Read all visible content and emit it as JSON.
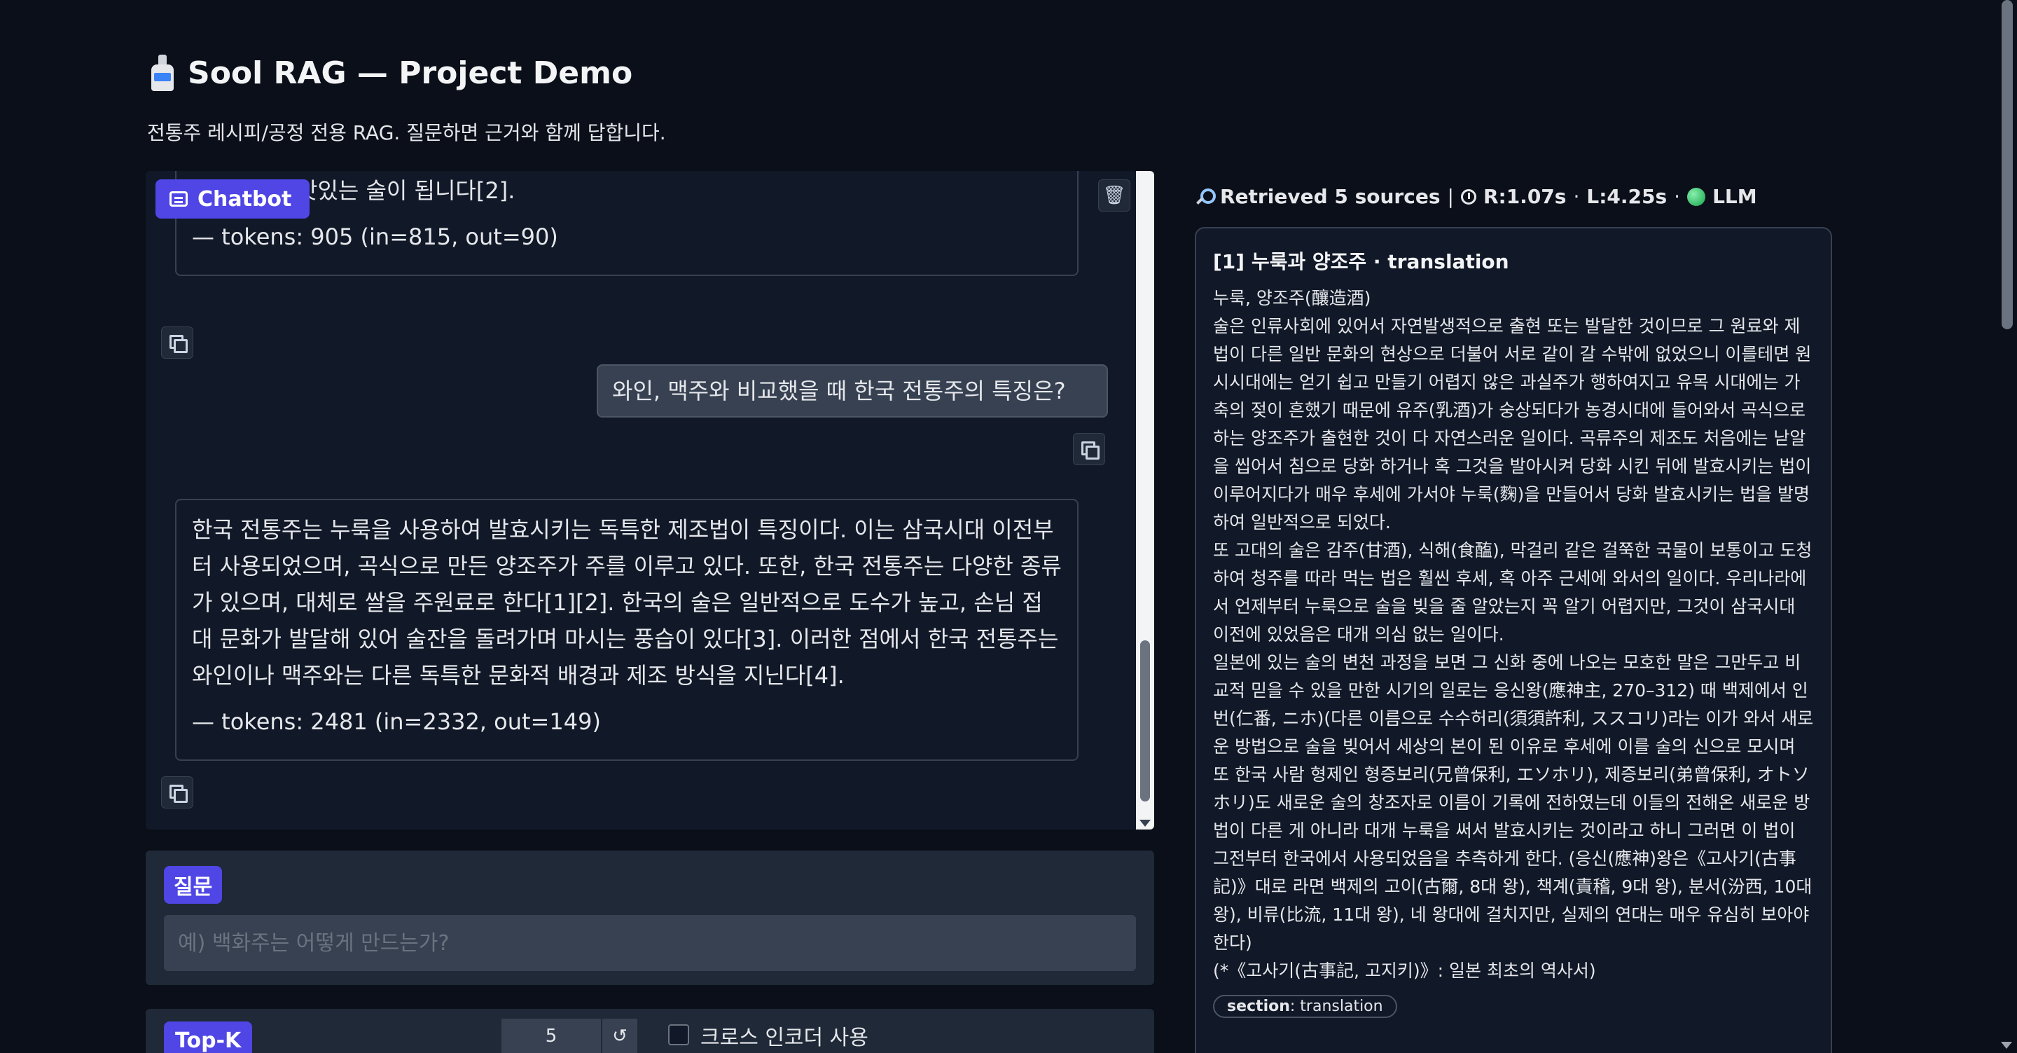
{
  "app": {
    "title": "Sool RAG — Project Demo",
    "subtitle": "전통주 레시피/공정 전용 RAG. 질문하면 근거와 함께 답합니다."
  },
  "icons": {
    "logo": "sake-bottle-icon",
    "chatbot": "chat-icon",
    "trash": "trash-icon",
    "copy": "copy-icon",
    "search": "magnifier-icon",
    "timer": "timer-icon",
    "status": "green-dot-icon"
  },
  "chat": {
    "badge_label": "Chatbot",
    "trash_glyph": "🗑",
    "messages": [
      {
        "role": "assistant",
        "text": "맛있는 술이 됩니다[2].",
        "tokens": "— tokens: 905 (in=815, out=90)"
      },
      {
        "role": "user",
        "text": "와인, 맥주와 비교했을 때 한국 전통주의 특징은?"
      },
      {
        "role": "assistant",
        "text": "한국 전통주는 누룩을 사용하여 발효시키는 독특한 제조법이 특징이다. 이는 삼국시대 이전부터 사용되었으며, 곡식으로 만든 양조주가 주를 이루고 있다. 또한, 한국 전통주는 다양한 종류가 있으며, 대체로 쌀을 주원료로 한다[1][2]. 한국의 술은 일반적으로 도수가 높고, 손님 접대 문화가 발달해 있어 술잔을 돌려가며 마시는 풍습이 있다[3]. 이러한 점에서 한국 전통주는 와인이나 맥주와는 다른 독특한 문화적 배경과 제조 방식을 지닌다[4].",
        "tokens": "— tokens: 2481 (in=2332, out=149)"
      }
    ]
  },
  "question": {
    "label": "질문",
    "placeholder": "예) 백화주는 어떻게 만드는가?",
    "value": ""
  },
  "topk": {
    "label": "Top-K",
    "value": "5",
    "reset_glyph": "↺",
    "cross_encoder_label": "크로스 인코더 사용",
    "cross_encoder_checked": false
  },
  "retrieved": {
    "summary": "Retrieved 5 sources",
    "separator": "|",
    "retrieval_time": "R:1.07s",
    "dot": "·",
    "llm_time": "L:4.25s",
    "llm_label": "LLM",
    "sources": [
      {
        "title": "[1] 누룩과 양조주 · translation",
        "body": "누룩, 양조주(釀造酒)\n술은 인류사회에 있어서 자연발생적으로 출현 또는 발달한 것이므로 그 원료와 제법이 다른 일반 문화의 현상으로 더불어 서로 같이 갈 수밖에 없었으니 이를테면 원시시대에는 얻기 쉽고 만들기 어렵지 않은 과실주가 행하여지고 유목 시대에는 가축의 젖이 흔했기 때문에 유주(乳酒)가 숭상되다가 농경시대에 들어와서 곡식으로 하는 양조주가 출현한 것이 다 자연스러운 일이다. 곡류주의 제조도 처음에는 낟알을 씹어서 침으로 당화 하거나 혹 그것을 발아시켜 당화 시킨 뒤에 발효시키는 법이 이루어지다가 매우 후세에 가서야 누룩(麴)을 만들어서 당화 발효시키는 법을 발명하여 일반적으로 되었다.\n또 고대의 술은 감주(甘酒), 식해(食醢), 막걸리 같은 걸쭉한 국물이 보통이고 도청하여 청주를 따라 먹는 법은 훨씬 후세, 혹 아주 근세에 와서의 일이다. 우리나라에서 언제부터 누룩으로 술을 빚을 줄 알았는지 꼭 알기 어렵지만, 그것이 삼국시대 이전에 있었음은 대개 의심 없는 일이다.\n일본에 있는 술의 변천 과정을 보면 그 신화 중에 나오는 모호한 말은 그만두고 비교적 믿을 수 있을 만한 시기의 일로는 응신왕(應神主, 270–312) 때 백제에서 인번(仁番, ニホ)(다른 이름으로 수수허리(須須許利, ススコリ)라는 이가 와서 새로운 방법으로 술을 빚어서 세상의 본이 된 이유로 후세에 이를 술의 신으로 모시며 또 한국 사람 형제인 형증보리(兄曾保利, エソホリ), 제증보리(弟曾保利, オトソホリ)도 새로운 술의 창조자로 이름이 기록에 전하였는데 이들의 전해온 새로운 방법이 다른 게 아니라 대개 누룩을 써서 발효시키는 것이라고 하니 그러면 이 법이 그전부터 한국에서 사용되었음을 추측하게 한다. (응신(應神)왕은《고사기(古事記)》대로 라면 백제의 고이(古爾, 8대 왕), 책계(責稽, 9대 왕), 분서(汾西, 10대 왕), 비류(比流, 11대 왕), 네 왕대에 걸치지만, 실제의 연대는 매우 유심히 보아야 한다)\n(*《고사기(古事記, 고지키)》: 일본 최초의 역사서)",
        "tag_key": "section",
        "tag_value": "translation"
      }
    ]
  },
  "colors": {
    "background": "#0b0f19",
    "panel": "#111827",
    "accent": "#4f46e5",
    "status": "#22c55e"
  }
}
